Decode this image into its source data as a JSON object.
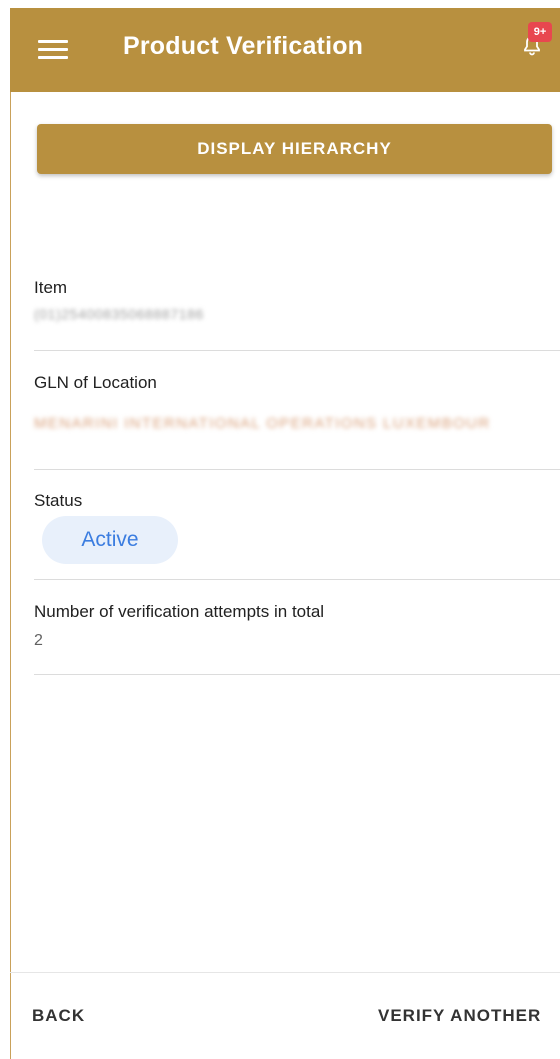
{
  "appbar": {
    "title": "Product Verification",
    "notification_badge": "9+",
    "accent_color": "#b8903f",
    "badge_color": "#e8474f"
  },
  "actions": {
    "display_hierarchy_label": "DISPLAY HIERARCHY",
    "back_label": "BACK",
    "verify_another_label": "VERIFY ANOTHER"
  },
  "fields": {
    "item": {
      "label": "Item",
      "value": "(01)25400835068887186"
    },
    "gln": {
      "label": "GLN of Location",
      "value": "MENARINI INTERNATIONAL OPERATIONS LUXEMBOUR"
    },
    "status": {
      "label": "Status",
      "value": "Active",
      "chip_color": "#e8f0fb",
      "text_color": "#3b7de0"
    },
    "attempts": {
      "label": "Number of verification attempts in total",
      "value": "2"
    }
  },
  "icons": {
    "menu": "menu-icon",
    "bell": "bell-icon"
  }
}
